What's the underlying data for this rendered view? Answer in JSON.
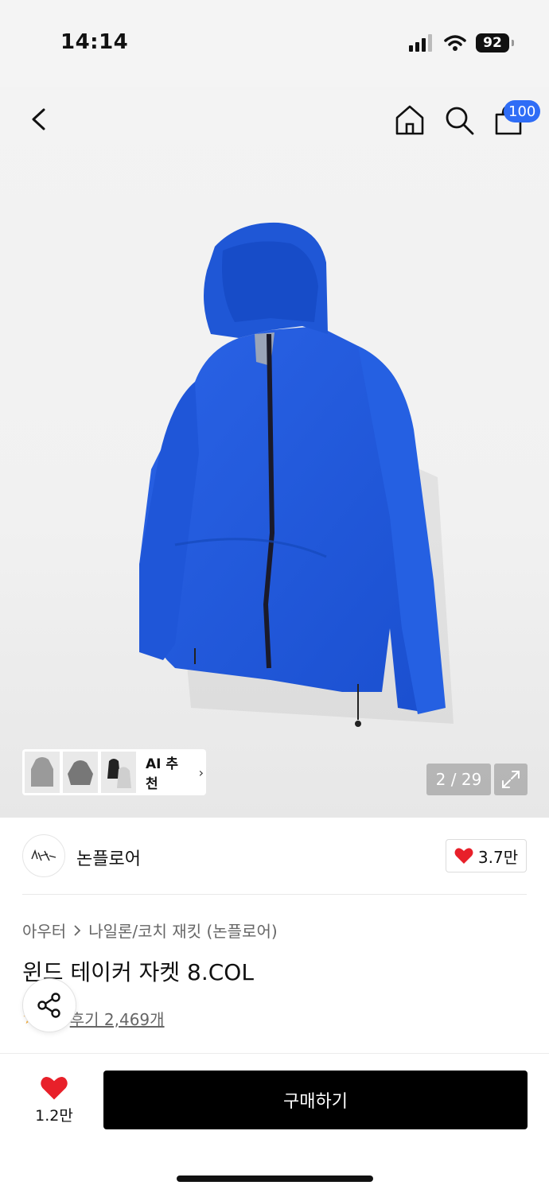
{
  "status_bar": {
    "time": "14:14",
    "battery": "92"
  },
  "nav": {
    "cart_badge": "100"
  },
  "gallery": {
    "ai_label": "AI 추천",
    "ai_chevron": "›",
    "page_counter": "2 / 29"
  },
  "brand": {
    "name": "논플로어",
    "like_count": "3.7만"
  },
  "product": {
    "category": "아우터",
    "subcategory": "나일론/코치 재킷 (논플로어)",
    "title": "윈드 테이커 자켓 8.COL",
    "review_text": "후기 2,469개"
  },
  "bottom_bar": {
    "wish_count": "1.2만",
    "buy_label": "구매하기"
  },
  "colors": {
    "accent_blue": "#2f6df6",
    "heart_red": "#e8202a",
    "jacket_blue": "#1f57d6"
  }
}
